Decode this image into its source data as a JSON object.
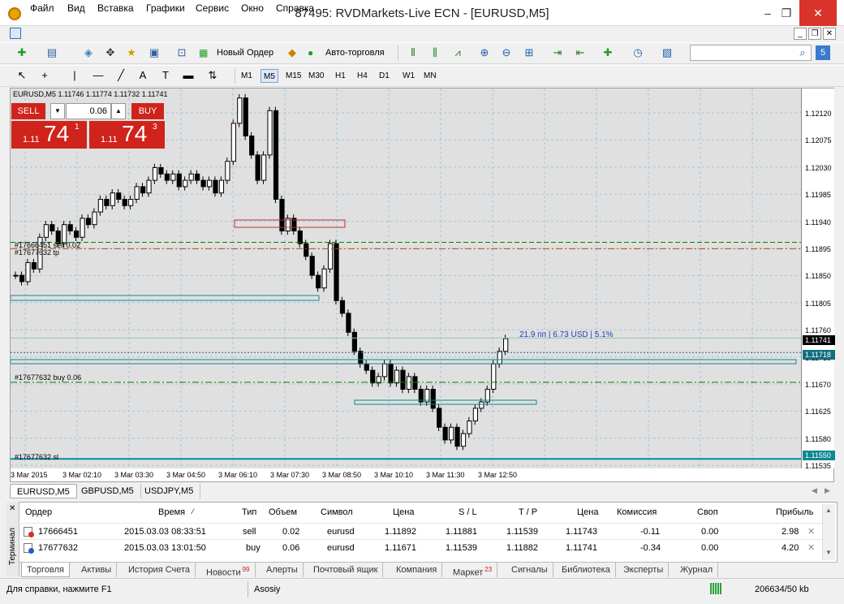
{
  "window": {
    "title": "87495: RVDMarkets-Live ECN - [EURUSD,M5]",
    "minimize": "–",
    "maximize": "❐",
    "close": "✕"
  },
  "menu": [
    "Файл",
    "Вид",
    "Вставка",
    "Графики",
    "Сервис",
    "Окно",
    "Справка"
  ],
  "mdi": {
    "min": "_",
    "restore": "❐",
    "close": "✕"
  },
  "toolbar": {
    "new_order": "Новый Ордер",
    "auto_trading": "Авто-торговля",
    "search_value": ""
  },
  "timeframes": [
    "M1",
    "M5",
    "M15",
    "M30",
    "H1",
    "H4",
    "D1",
    "W1",
    "MN"
  ],
  "chart": {
    "header": "EURUSD,M5  1.11746 1.11774 1.11732 1.11741",
    "oneclick": {
      "sell_label": "SELL",
      "buy_label": "BUY",
      "volume": "0.06",
      "sell_prefix": "1.11",
      "sell_big": "74",
      "sell_sup": "1",
      "buy_prefix": "1.11",
      "buy_big": "74",
      "buy_sup": "3"
    },
    "annotations": {
      "order1": "#17666451 sell 0.02",
      "order2": "#17677632 tp",
      "buy_line": "#17677632 buy 0.06",
      "sl_line": "#17677632 sl",
      "profit_info": "21.9 пп | 6.73 USD | 5.1%"
    },
    "price_labels": [
      "1.12120",
      "1.12075",
      "1.12030",
      "1.11985",
      "1.11940",
      "1.11895",
      "1.11850",
      "1.11805",
      "1.11760",
      "1.11715",
      "1.11670",
      "1.11625",
      "1.11580",
      "1.11535"
    ],
    "current_bid": "1.11741",
    "buy_open": "1.11718",
    "sl_price": "1.11550",
    "time_labels": [
      "3 Mar 2015",
      "3 Mar 02:10",
      "3 Mar 03:30",
      "3 Mar 04:50",
      "3 Mar 06:10",
      "3 Mar 07:30",
      "3 Mar 08:50",
      "3 Mar 10:10",
      "3 Mar 11:30",
      "3 Mar 12:50"
    ]
  },
  "chart_data": {
    "type": "candlestick",
    "symbol": "EURUSD",
    "timeframe": "M5",
    "ylim": [
      1.11535,
      1.12135
    ],
    "closes": [
      1.1184,
      1.1183,
      1.1186,
      1.1185,
      1.119,
      1.1192,
      1.1191,
      1.1189,
      1.1192,
      1.1191,
      1.119,
      1.1193,
      1.1192,
      1.1194,
      1.1196,
      1.1195,
      1.1197,
      1.1196,
      1.1195,
      1.1196,
      1.1198,
      1.1197,
      1.1199,
      1.1201,
      1.12,
      1.1199,
      1.12,
      1.1198,
      1.1199,
      1.12,
      1.1199,
      1.1198,
      1.1199,
      1.1197,
      1.1199,
      1.1202,
      1.1208,
      1.1212,
      1.1206,
      1.1203,
      1.1199,
      1.1203,
      1.121,
      1.1196,
      1.1191,
      1.1193,
      1.1191,
      1.1189,
      1.1187,
      1.1184,
      1.1182,
      1.1185,
      1.1189,
      1.118,
      1.1178,
      1.1175,
      1.1172,
      1.117,
      1.1169,
      1.1167,
      1.1168,
      1.117,
      1.1167,
      1.1169,
      1.1166,
      1.1168,
      1.1166,
      1.1164,
      1.1166,
      1.1163,
      1.116,
      1.1158,
      1.116,
      1.1157,
      1.1159,
      1.1161,
      1.1163,
      1.1164,
      1.1166,
      1.117,
      1.1172,
      1.1174
    ],
    "lines": [
      {
        "name": "#17666451 sell 0.02",
        "price": 1.11892,
        "style": "dash",
        "color": "#008000"
      },
      {
        "name": "#17677632 tp",
        "price": 1.11882,
        "style": "dashdot",
        "color": "#d04000"
      },
      {
        "name": "#17677632 buy 0.06",
        "price": 1.11671,
        "style": "dashdot",
        "color": "#008000"
      },
      {
        "name": "#17677632 sl",
        "price": 1.1155,
        "style": "solid",
        "color": "#0090a0"
      },
      {
        "name": "bid",
        "price": 1.11741,
        "style": "solid",
        "color": "#a0c0c0"
      },
      {
        "name": "buy open",
        "price": 1.11718,
        "style": "dot",
        "color": "#2060a0"
      }
    ]
  },
  "symbol_tabs": [
    "EURUSD,M5",
    "GBPUSD,M5",
    "USDJPY,M5"
  ],
  "terminal": {
    "side_label": "Терминал",
    "headers": [
      "Ордер",
      "Время",
      "Тип",
      "Объем",
      "Символ",
      "Цена",
      "S / L",
      "T / P",
      "Цена",
      "Комиссия",
      "Своп",
      "Прибыль"
    ],
    "rows": [
      [
        "17666451",
        "2015.03.03 08:33:51",
        "sell",
        "0.02",
        "eurusd",
        "1.11892",
        "1.11881",
        "1.11539",
        "1.11743",
        "-0.11",
        "0.00",
        "2.98"
      ],
      [
        "17677632",
        "2015.03.03 13:01:50",
        "buy",
        "0.06",
        "eurusd",
        "1.11671",
        "1.11539",
        "1.11882",
        "1.11741",
        "-0.34",
        "0.00",
        "4.20"
      ]
    ],
    "tabs": [
      {
        "label": "Торговля"
      },
      {
        "label": "Активы"
      },
      {
        "label": "История Счета"
      },
      {
        "label": "Новости",
        "badge": "99"
      },
      {
        "label": "Алерты"
      },
      {
        "label": "Почтовый ящик"
      },
      {
        "label": "Компания"
      },
      {
        "label": "Маркет",
        "badge": "23"
      },
      {
        "label": "Сигналы"
      },
      {
        "label": "Библиотека"
      },
      {
        "label": "Эксперты"
      },
      {
        "label": "Журнал"
      }
    ]
  },
  "status": {
    "help": "Для справки, нажмите F1",
    "profile": "Asosiy",
    "traffic": "206634/50 kb"
  }
}
